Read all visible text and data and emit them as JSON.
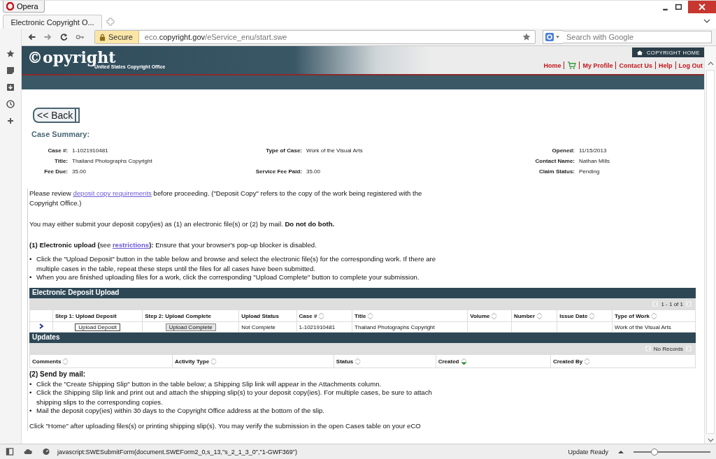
{
  "browser": {
    "menu_button": "Opera",
    "tab": {
      "title": "Electronic Copyright O..."
    },
    "address": {
      "secure_label": "Secure",
      "url_host": "eco.",
      "url_domain": "copyright.gov",
      "url_path": "/eService_enu/start.swe"
    },
    "search": {
      "placeholder": "Search with Google"
    }
  },
  "site_header": {
    "logo": "©opyright",
    "subtitle": "United States Copyright Office",
    "home_button": "COPYRIGHT HOME",
    "nav": [
      {
        "label": "Home",
        "kind": "link"
      },
      {
        "kind": "cart"
      },
      {
        "label": "My Profile",
        "kind": "link"
      },
      {
        "label": "Contact Us",
        "kind": "link"
      },
      {
        "label": "Help",
        "kind": "link"
      },
      {
        "label": "Log Out",
        "kind": "link"
      }
    ]
  },
  "back_button": "<< Back",
  "case_summary": {
    "title": "Case Summary:",
    "rows": [
      [
        {
          "kind": "field",
          "label": "Case #:",
          "value": "1-1021910481"
        },
        {
          "kind": "field",
          "label": "Type of Case:",
          "value": "Work of the Visual Arts"
        },
        {
          "kind": "field",
          "label": "Opened:",
          "value": "11/15/2013"
        }
      ],
      [
        {
          "kind": "field",
          "label": "Title:",
          "value": "Thailand Photographs Copyright"
        },
        {
          "kind": "blank"
        },
        {
          "kind": "field",
          "label": "Contact Name:",
          "value": "Nathan Mills"
        }
      ],
      [
        {
          "kind": "field",
          "label": "Fee Due:",
          "value": "35.00"
        },
        {
          "kind": "field",
          "label": "Service Fee Paid:",
          "value": "35.00"
        },
        {
          "kind": "field",
          "label": "Claim Status:",
          "value": "Pending"
        }
      ]
    ]
  },
  "intro": [
    {
      "kind": "paragraph",
      "parts": [
        {
          "kind": "text",
          "text": "Please review "
        },
        {
          "kind": "link",
          "text": "deposit copy requirements"
        },
        {
          "kind": "text",
          "text": " before proceeding. (\"Deposit Copy\" refers to the copy of the work being registered with the Copyright Office.)"
        }
      ]
    },
    {
      "kind": "paragraph",
      "parts": [
        {
          "kind": "text",
          "text": "You may either submit your deposit copy(ies) as (1) an electronic file(s) or (2) by mail. **Do not do both.**"
        }
      ]
    },
    {
      "kind": "paragraph",
      "parts": [
        {
          "kind": "text",
          "text": "**(1) Electronic upload (**see "
        },
        {
          "kind": "link",
          "text": "**restrictions**"
        },
        {
          "kind": "text",
          "text": "**):**  Ensure that your browser's pop-up blocker is disabled."
        }
      ]
    },
    {
      "kind": "bullet",
      "marker": "•",
      "text": "Click the \"Upload Deposit\" button in the table below and browse and select the electronic file(s) for the corresponding work. If there are multiple cases in the table, repeat these steps until the files for all cases have been submitted."
    },
    {
      "kind": "bullet",
      "marker": "•",
      "text": "When you are finished uploading files for a work, click the corresponding \"Upload Complete\" button to complete your submission."
    }
  ],
  "deposit_table": {
    "title": "Electronic Deposit Upload",
    "pager": "1 - 1 of 1",
    "columns": [
      {
        "kind": "select"
      },
      {
        "kind": "button",
        "label": "Step 1: Upload Deposit"
      },
      {
        "kind": "button",
        "label": "Step 2: Upload Complete"
      },
      {
        "kind": "text",
        "label": "Upload Status"
      },
      {
        "kind": "text",
        "label": "Case #",
        "sortable": true,
        "sorted": false
      },
      {
        "kind": "text",
        "label": "Title",
        "sortable": true,
        "sorted": false
      },
      {
        "kind": "text",
        "label": "Volume",
        "sortable": true,
        "sorted": false
      },
      {
        "kind": "text",
        "label": "Number",
        "sortable": true,
        "sorted": false
      },
      {
        "kind": "text",
        "label": "Issue Date",
        "sortable": true,
        "sorted": false
      },
      {
        "kind": "text",
        "label": "Type of Work",
        "sortable": true,
        "sorted": false
      }
    ],
    "rows": [
      {
        "selected": true,
        "cells": [
          "",
          "Upload Deposit",
          "Upload Complete",
          "Not Complete",
          "1-1021910481",
          "Thailand Photographs Copyright",
          "",
          "",
          "",
          "Work of the Visual Arts"
        ]
      }
    ]
  },
  "updates_table": {
    "title": "Updates",
    "pager": "No Records",
    "columns": [
      {
        "label": "Comments",
        "sortable": true,
        "sorted": false
      },
      {
        "label": "Activity Type",
        "sortable": true,
        "sorted": false
      },
      {
        "label": "Status",
        "sortable": true,
        "sorted": false
      },
      {
        "label": "Created",
        "sortable": true,
        "sorted": true
      },
      {
        "label": "Created By",
        "sortable": true,
        "sorted": false
      }
    ]
  },
  "mail": [
    {
      "kind": "heading",
      "text": "(2) Send by mail:"
    },
    {
      "kind": "bullet",
      "marker": "•",
      "text": "Click the \"Create Shipping Slip\" button in the table below; a Shipping Slip link will appear in the Attachments column."
    },
    {
      "kind": "bullet",
      "marker": "•",
      "text": "Click the Shipping Slip link and print out and attach the shipping slip(s) to your deposit copy(ies). For multiple cases, be sure to attach shipping slips to the corresponding copies."
    },
    {
      "kind": "bullet",
      "marker": "•",
      "text": "Mail the deposit copy(ies) within 30 days to the Copyright Office address at the bottom of the slip."
    },
    {
      "kind": "paragraph",
      "text": "Click \"Home\" after uploading files(s) or printing shipping slip(s). You may verify the submission in the open Cases table on your eCO"
    }
  ],
  "status_bar": {
    "url": "javascript:SWESubmitForm(document.SWEForm2_0,s_13,\"s_2_1_3_0\",\"1-GWF369\")",
    "update": "Update Ready",
    "zoom": {
      "level": 0.27
    }
  }
}
